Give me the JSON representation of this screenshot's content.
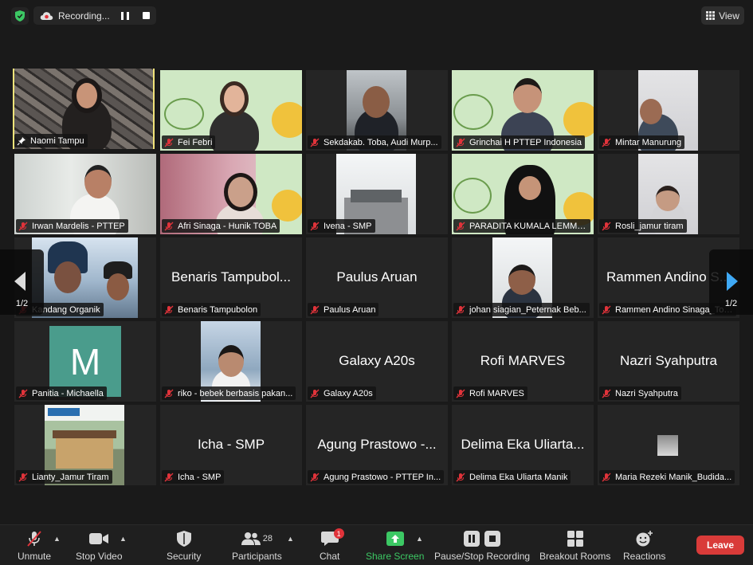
{
  "top_bar": {
    "recording_label": "Recording...",
    "view_label": "View"
  },
  "pager": {
    "left": "1/2",
    "right": "1/2"
  },
  "tiles": [
    {
      "name": "Naomi Tampu"
    },
    {
      "name": "Fei Febri"
    },
    {
      "name": "Sekdakab. Toba, Audi Murp..."
    },
    {
      "name": "Grinchai H PTTEP Indonesia"
    },
    {
      "name": "Mintar Manurung"
    },
    {
      "name": "Irwan Mardelis - PTTEP"
    },
    {
      "name": "Afri Sinaga - Hunik TOBA"
    },
    {
      "name": "Ivena - SMP"
    },
    {
      "name": "PARADITA KUMALA LEMMY..."
    },
    {
      "name": "Rosli_jamur tiram"
    },
    {
      "name": "Kandang Organik"
    },
    {
      "name": "Benaris Tampubolon",
      "display": "Benaris Tampubol..."
    },
    {
      "name": "Paulus Aruan",
      "display": "Paulus Aruan"
    },
    {
      "name": "johan siagian_Peternak Beb..."
    },
    {
      "name": "Rammen Andino Sinaga_Toba",
      "display": "Rammen Andino S..."
    },
    {
      "name": "Panitia - Michaella",
      "avatar": "M"
    },
    {
      "name": "riko - bebek berbasis pakan..."
    },
    {
      "name": "Galaxy A20s",
      "display": "Galaxy A20s"
    },
    {
      "name": "Rofi MARVES",
      "display": "Rofi MARVES"
    },
    {
      "name": "Nazri Syahputra",
      "display": "Nazri Syahputra"
    },
    {
      "name": "Lianty_Jamur Tiram"
    },
    {
      "name": "Icha - SMP",
      "display": "Icha - SMP"
    },
    {
      "name": "Agung Prastowo - PTTEP In...",
      "display": "Agung Prastowo -..."
    },
    {
      "name": "Delima Eka Uliarta Manik",
      "display": "Delima Eka Uliarta..."
    },
    {
      "name": "Maria Rezeki Manik_Budida..."
    }
  ],
  "toolbar": {
    "unmute": "Unmute",
    "stop_video": "Stop Video",
    "security": "Security",
    "participants": "Participants",
    "participants_count": "28",
    "chat": "Chat",
    "chat_badge": "1",
    "share_screen": "Share Screen",
    "pause_stop_recording": "Pause/Stop Recording",
    "breakout_rooms": "Breakout Rooms",
    "reactions": "Reactions",
    "leave": "Leave"
  },
  "colors": {
    "background": "#1a1a1a",
    "tile": "#252525",
    "active_speaker_border": "#f2e47a",
    "share_green": "#3cc864",
    "leave_red": "#d93b39"
  }
}
